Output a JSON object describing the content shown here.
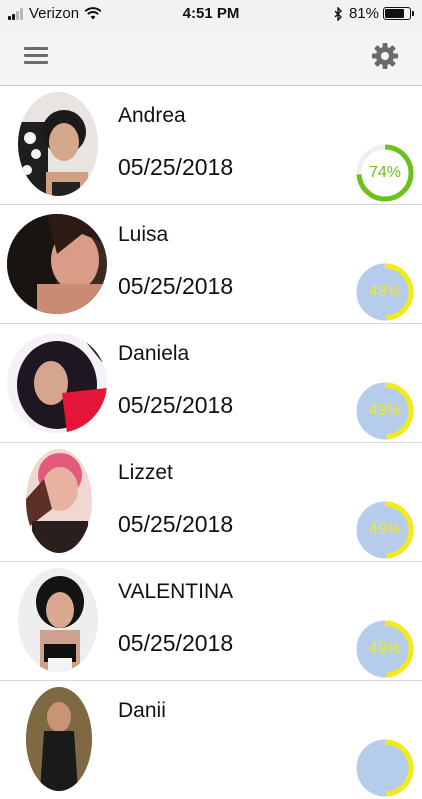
{
  "status_bar": {
    "carrier": "Verizon",
    "time": "4:51 PM",
    "battery_percent_label": "81%",
    "battery_level": 0.81,
    "signal_bars_filled": 2,
    "signal_bars_total": 4
  },
  "nav": {
    "menu_icon": "hamburger-menu-icon",
    "settings_icon": "gear-icon"
  },
  "profiles": [
    {
      "name": "Andrea",
      "date": "05/25/2018",
      "percent_label": "74%",
      "percent": 0.74,
      "ring_color": "#6cc11a",
      "text_color": "#6cc11a",
      "fill": "#ffffff"
    },
    {
      "name": "Luisa",
      "date": "05/25/2018",
      "percent_label": "49%",
      "percent": 0.49,
      "ring_color": "#f2ea1d",
      "text_color": "#f2ea1d",
      "fill": "#b5cdeb"
    },
    {
      "name": "Daniela",
      "date": "05/25/2018",
      "percent_label": "49%",
      "percent": 0.49,
      "ring_color": "#f2ea1d",
      "text_color": "#f2ea1d",
      "fill": "#b5cdeb"
    },
    {
      "name": "Lizzet",
      "date": "05/25/2018",
      "percent_label": "49%",
      "percent": 0.49,
      "ring_color": "#f2ea1d",
      "text_color": "#f2ea1d",
      "fill": "#b5cdeb"
    },
    {
      "name": "VALENTINA",
      "date": "05/25/2018",
      "percent_label": "49%",
      "percent": 0.49,
      "ring_color": "#f2ea1d",
      "text_color": "#f2ea1d",
      "fill": "#b5cdeb"
    },
    {
      "name": "Danii",
      "date": "",
      "percent_label": "",
      "percent": 0.49,
      "ring_color": "#f2ea1d",
      "text_color": "#f2ea1d",
      "fill": "#b5cdeb"
    }
  ]
}
